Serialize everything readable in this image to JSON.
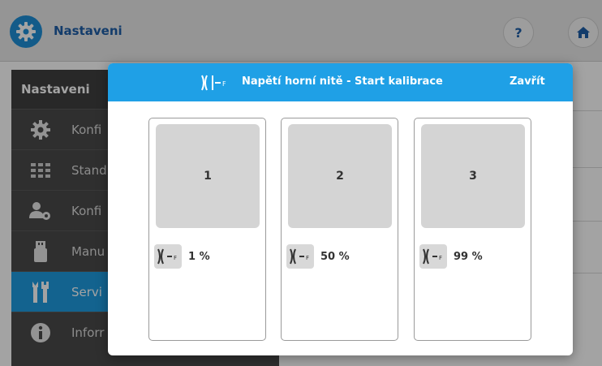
{
  "app": {
    "title": "Nastaveni",
    "help_label": "?"
  },
  "sidebar": {
    "header": "Nastaveni",
    "items": [
      {
        "label": "Konfi",
        "icon": "gear-icon"
      },
      {
        "label": "Stand",
        "icon": "grid-icon"
      },
      {
        "label": "Konfi",
        "icon": "user-gear-icon"
      },
      {
        "label": "Manu",
        "icon": "usb-icon"
      },
      {
        "label": "Servi",
        "icon": "tools-icon",
        "active": true
      },
      {
        "label": "Inforr",
        "icon": "info-icon"
      }
    ]
  },
  "modal": {
    "title": "Napětí horní nitě - Start kalibrace",
    "close_label": "Zavřít",
    "cards": [
      {
        "number": "1",
        "percent": "1 %"
      },
      {
        "number": "2",
        "percent": "50 %"
      },
      {
        "number": "3",
        "percent": "99 %"
      }
    ]
  },
  "colors": {
    "accent": "#1fa0e6",
    "sidebar_bg": "#4a4a4a",
    "tile_bg": "#d4d4d4",
    "title_blue": "#1f5fa8"
  }
}
